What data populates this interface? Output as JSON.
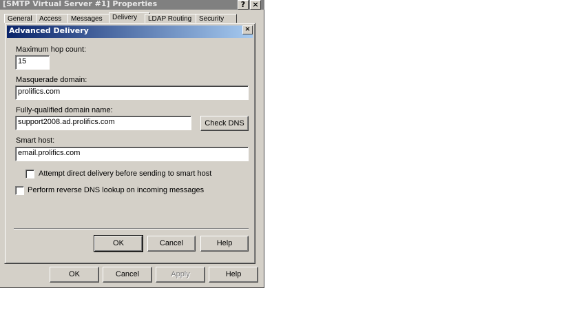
{
  "outer": {
    "title": "[SMTP Virtual Server #1] Properties",
    "help_glyph": "?",
    "close_glyph": "×",
    "tabs": [
      {
        "label": "General"
      },
      {
        "label": "Access"
      },
      {
        "label": "Messages"
      },
      {
        "label": "Delivery"
      },
      {
        "label": "LDAP Routing"
      },
      {
        "label": "Security"
      }
    ],
    "buttons": {
      "ok": "OK",
      "cancel": "Cancel",
      "apply": "Apply",
      "help": "Help"
    }
  },
  "dialog": {
    "title": "Advanced Delivery",
    "close_glyph": "×",
    "max_hop": {
      "label": "Maximum hop count:",
      "value": "15"
    },
    "masquerade": {
      "label": "Masquerade domain:",
      "value": "prolifics.com"
    },
    "fqdn": {
      "label": "Fully-qualified domain name:",
      "value": "support2008.ad.prolifics.com",
      "button": "Check DNS"
    },
    "smart_host": {
      "label": "Smart host:",
      "value": "email.prolifics.com"
    },
    "attempt_direct": {
      "label": "Attempt direct delivery before sending to smart host",
      "checked": false
    },
    "reverse_dns": {
      "label": "Perform reverse DNS lookup on incoming messages",
      "checked": false
    },
    "buttons": {
      "ok": "OK",
      "cancel": "Cancel",
      "help": "Help"
    }
  },
  "colors": {
    "face": "#d4d0c8",
    "active_title_start": "#0a246a",
    "active_title_end": "#a6caf0",
    "inactive_title": "#808080"
  }
}
